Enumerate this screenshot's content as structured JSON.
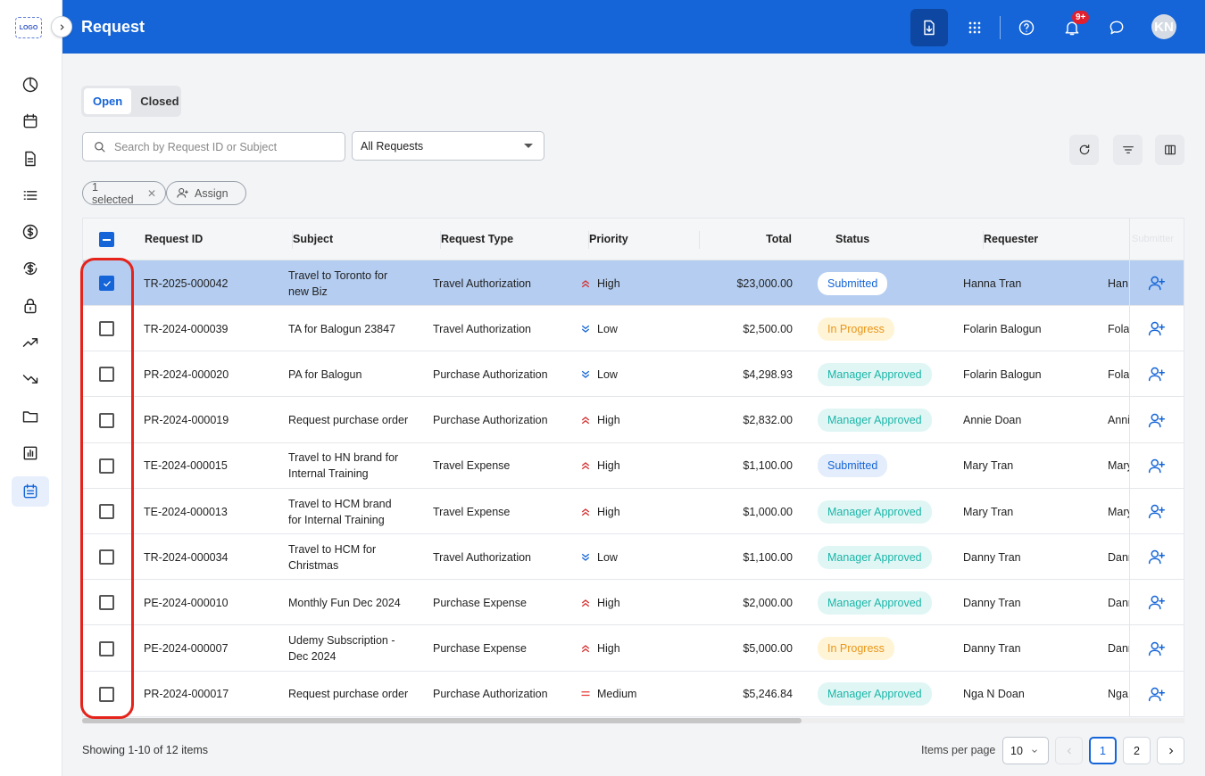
{
  "sidebar": {
    "logo_text": "LOGO",
    "items": [
      {
        "icon": "pie-chart-icon"
      },
      {
        "icon": "calendar-icon"
      },
      {
        "icon": "document-icon"
      },
      {
        "icon": "list-icon"
      },
      {
        "icon": "dollar-icon"
      },
      {
        "icon": "dollar-refresh-icon"
      },
      {
        "icon": "lock-icon"
      },
      {
        "icon": "trending-up-icon"
      },
      {
        "icon": "trending-down-icon"
      },
      {
        "icon": "folder-icon"
      },
      {
        "icon": "bar-chart-icon"
      },
      {
        "icon": "request-list-icon",
        "active": true
      }
    ]
  },
  "header": {
    "title": "Request",
    "notification_badge": "9+",
    "avatar_initials": "KN",
    "color": "#1565d8"
  },
  "tabs": [
    {
      "label": "Open",
      "active": true
    },
    {
      "label": "Closed",
      "active": false
    }
  ],
  "search": {
    "placeholder": "Search by Request ID or Subject",
    "value": ""
  },
  "filter_select": {
    "value": "All Requests"
  },
  "selection": {
    "chip_label": "1 selected",
    "assign_label": "Assign"
  },
  "table": {
    "columns": [
      "Request ID",
      "Subject",
      "Request Type",
      "Priority",
      "Total",
      "Status",
      "Requester",
      "Submitter"
    ],
    "rows": [
      {
        "selected": true,
        "id": "TR-2025-000042",
        "subject_l1": "Travel to Toronto for",
        "subject_l2": "new Biz",
        "type": "Travel Authorization",
        "priority": "High",
        "total": "$23,000.00",
        "status": "Submitted",
        "requester": "Hanna Tran",
        "submitter": "Han"
      },
      {
        "selected": false,
        "id": "TR-2024-000039",
        "subject_l1": "TA for Balogun 23847",
        "subject_l2": "",
        "type": "Travel Authorization",
        "priority": "Low",
        "total": "$2,500.00",
        "status": "In Progress",
        "requester": "Folarin Balogun",
        "submitter": "Fola"
      },
      {
        "selected": false,
        "id": "PR-2024-000020",
        "subject_l1": "PA for Balogun",
        "subject_l2": "",
        "type": "Purchase Authorization",
        "priority": "Low",
        "total": "$4,298.93",
        "status": "Manager Approved",
        "requester": "Folarin Balogun",
        "submitter": "Fola"
      },
      {
        "selected": false,
        "id": "PR-2024-000019",
        "subject_l1": "Request purchase order",
        "subject_l2": "",
        "type": "Purchase Authorization",
        "priority": "High",
        "total": "$2,832.00",
        "status": "Manager Approved",
        "requester": "Annie Doan",
        "submitter": "Anni"
      },
      {
        "selected": false,
        "id": "TE-2024-000015",
        "subject_l1": "Travel to HN brand for",
        "subject_l2": "Internal Training",
        "type": "Travel Expense",
        "priority": "High",
        "total": "$1,100.00",
        "status": "Submitted",
        "requester": "Mary Tran",
        "submitter": "Mary"
      },
      {
        "selected": false,
        "id": "TE-2024-000013",
        "subject_l1": "Travel to HCM brand",
        "subject_l2": "for Internal Training",
        "type": "Travel Expense",
        "priority": "High",
        "total": "$1,000.00",
        "status": "Manager Approved",
        "requester": "Mary Tran",
        "submitter": "Mary"
      },
      {
        "selected": false,
        "id": "TR-2024-000034",
        "subject_l1": "Travel to HCM for",
        "subject_l2": "Christmas",
        "type": "Travel Authorization",
        "priority": "Low",
        "total": "$1,100.00",
        "status": "Manager Approved",
        "requester": "Danny Tran",
        "submitter": "Dann"
      },
      {
        "selected": false,
        "id": "PE-2024-000010",
        "subject_l1": "Monthly Fun Dec 2024",
        "subject_l2": "",
        "type": "Purchase Expense",
        "priority": "High",
        "total": "$2,000.00",
        "status": "Manager Approved",
        "requester": "Danny Tran",
        "submitter": "Dann"
      },
      {
        "selected": false,
        "id": "PE-2024-000007",
        "subject_l1": "Udemy Subscription -",
        "subject_l2": "Dec 2024",
        "type": "Purchase Expense",
        "priority": "High",
        "total": "$5,000.00",
        "status": "In Progress",
        "requester": "Danny Tran",
        "submitter": "Dann"
      },
      {
        "selected": false,
        "id": "PR-2024-000017",
        "subject_l1": "Request purchase order",
        "subject_l2": "",
        "type": "Purchase Authorization",
        "priority": "Medium",
        "total": "$5,246.84",
        "status": "Manager Approved",
        "requester": "Nga N Doan",
        "submitter": "Nga"
      }
    ]
  },
  "status_colors": {
    "Submitted": {
      "bg": "#ffffff",
      "fg": "#1565d8",
      "alt_bg": "#e3edfb"
    },
    "In Progress": {
      "bg": "#fff4d6",
      "fg": "#e8961a"
    },
    "Manager Approved": {
      "bg": "#e0f6f5",
      "fg": "#1bb5a7"
    }
  },
  "priority_colors": {
    "High": "#d32f2f",
    "Low": "#1565d8",
    "Medium": "#e53935"
  },
  "footer": {
    "showing": "Showing 1-10 of 12 items",
    "items_per_page_label": "Items per page",
    "items_per_page_value": "10",
    "pages": [
      "1",
      "2"
    ],
    "current_page": "1"
  }
}
